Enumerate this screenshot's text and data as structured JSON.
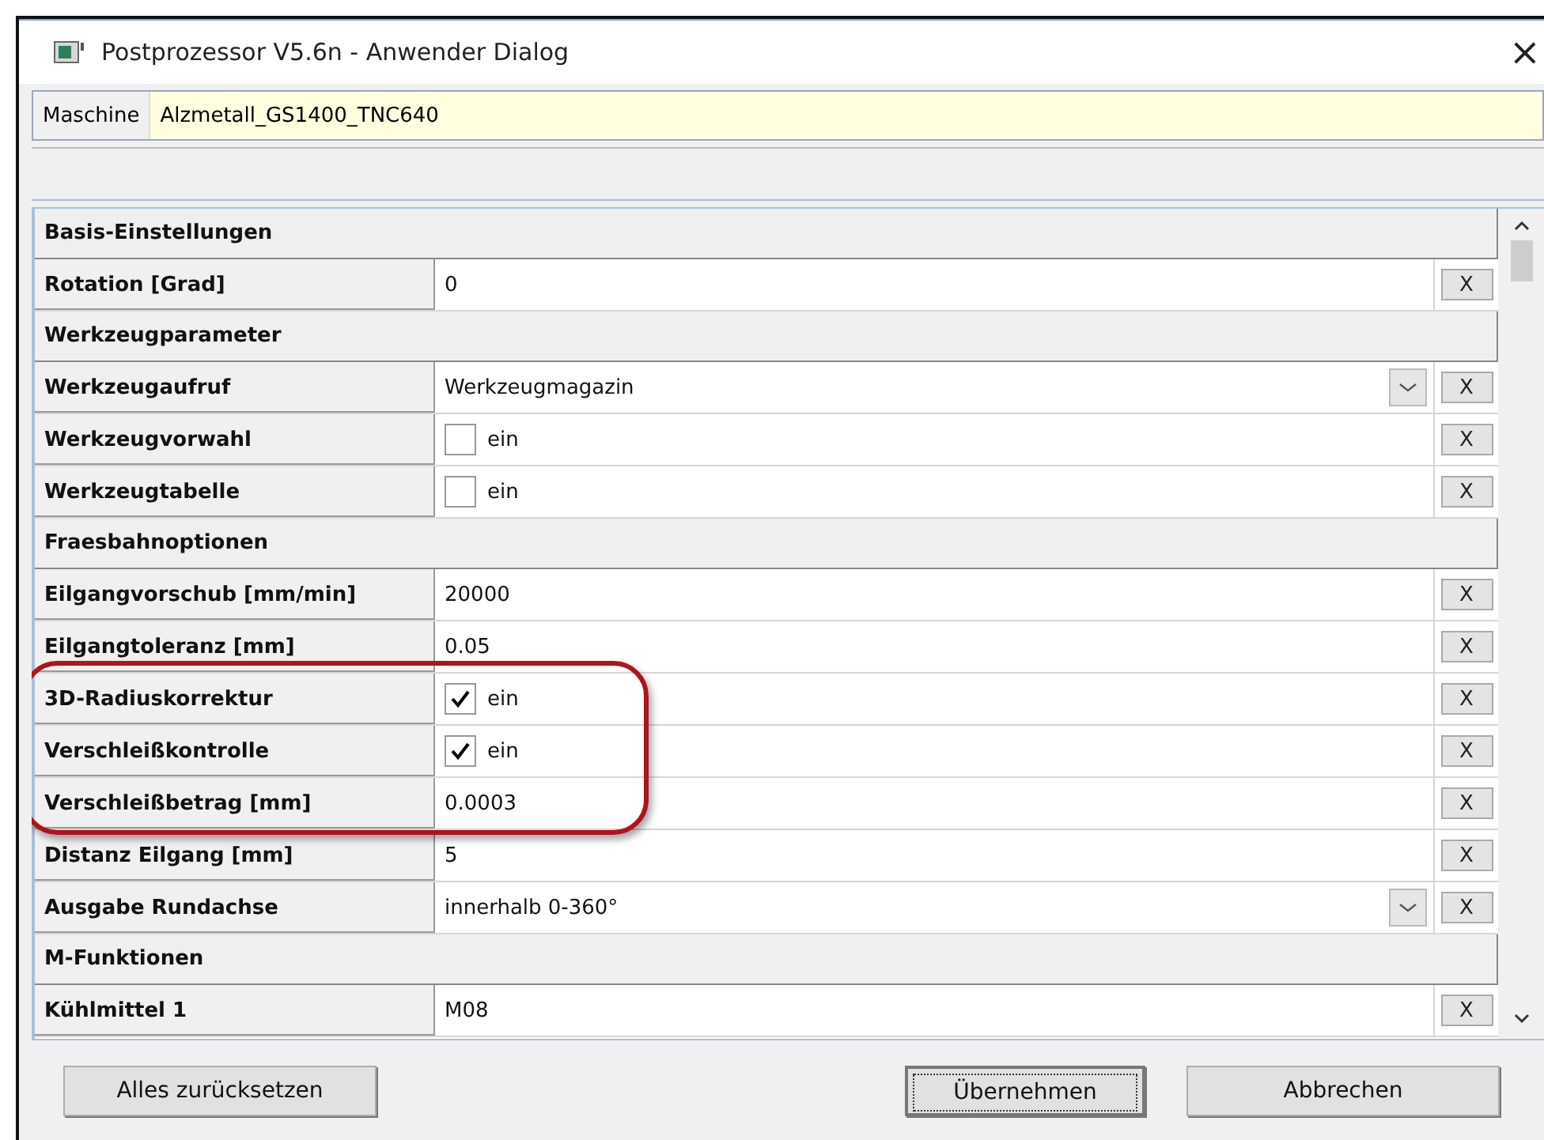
{
  "window": {
    "title": "Postprozessor V5.6n - Anwender Dialog",
    "close": "×"
  },
  "machine": {
    "label": "Maschine",
    "value": "Alzmetall_GS1400_TNC640"
  },
  "rows": [
    {
      "kind": "section",
      "label": "Basis-Einstellungen"
    },
    {
      "kind": "text",
      "label": "Rotation [Grad]",
      "value": "0",
      "reset": "X"
    },
    {
      "kind": "section",
      "label": "Werkzeugparameter"
    },
    {
      "kind": "dropdown",
      "label": "Werkzeugaufruf",
      "value": "Werkzeugmagazin",
      "reset": "X"
    },
    {
      "kind": "checkbox",
      "label": "Werkzeugvorwahl",
      "value": "ein",
      "checked": false,
      "reset": "X"
    },
    {
      "kind": "checkbox",
      "label": "Werkzeugtabelle",
      "value": "ein",
      "checked": false,
      "reset": "X"
    },
    {
      "kind": "section",
      "label": "Fraesbahnoptionen"
    },
    {
      "kind": "text",
      "label": "Eilgangvorschub [mm/min]",
      "value": "20000",
      "reset": "X"
    },
    {
      "kind": "text",
      "label": "Eilgangtoleranz [mm]",
      "value": "0.05",
      "reset": "X"
    },
    {
      "kind": "checkbox",
      "label": "3D-Radiuskorrektur",
      "value": "ein",
      "checked": true,
      "reset": "X"
    },
    {
      "kind": "checkbox",
      "label": "Verschleißkontrolle",
      "value": "ein",
      "checked": true,
      "reset": "X"
    },
    {
      "kind": "text",
      "label": "Verschleißbetrag [mm]",
      "value": "0.0003",
      "reset": "X"
    },
    {
      "kind": "text",
      "label": "Distanz Eilgang [mm]",
      "value": "5",
      "reset": "X"
    },
    {
      "kind": "dropdown",
      "label": "Ausgabe Rundachse",
      "value": "innerhalb 0-360°",
      "reset": "X"
    },
    {
      "kind": "section",
      "label": "M-Funktionen"
    },
    {
      "kind": "text",
      "label": "Kühlmittel 1",
      "value": "M08",
      "reset": "X"
    }
  ],
  "buttons": {
    "reset_all": "Alles zurücksetzen",
    "apply": "Übernehmen",
    "cancel": "Abbrechen"
  }
}
